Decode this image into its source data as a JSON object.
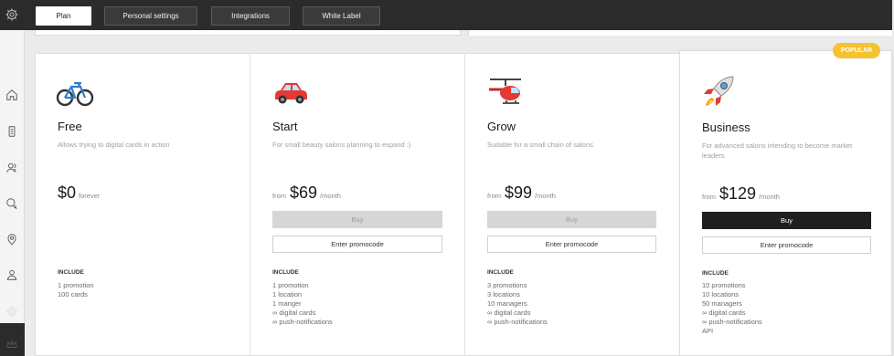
{
  "tabs": [
    "Plan",
    "Personal settings",
    "Integrations",
    "White Label"
  ],
  "badge": "POPULAR",
  "plans": [
    {
      "name": "Free",
      "desc": "Allows trying to digital cards in action",
      "from": "",
      "price": "$0",
      "per": "forever",
      "include": "INCLUDE",
      "features": [
        "1 promotion",
        "100 cards"
      ]
    },
    {
      "name": "Start",
      "desc": "For small beauty salons planning to expand :)",
      "from": "from",
      "price": "$69",
      "per": "/month",
      "buy": "Buy",
      "promo": "Enter promocode",
      "include": "INCLUDE",
      "features": [
        "1 promotion",
        "1 location",
        "1 manger",
        "∞ digital cards",
        "∞ push-notifications"
      ]
    },
    {
      "name": "Grow",
      "desc": "Suitable for a small chain of salons",
      "from": "from",
      "price": "$99",
      "per": "/month",
      "buy": "Buy",
      "promo": "Enter promocode",
      "include": "INCLUDE",
      "features": [
        "3 promotions",
        "3 locations",
        "10 managers",
        "∞ digital cards",
        "∞ push-notifications"
      ]
    },
    {
      "name": "Business",
      "desc": "For advanced salons intending to become market leaders",
      "from": "from",
      "price": "$129",
      "per": "/month",
      "buy": "Buy",
      "promo": "Enter promocode",
      "include": "INCLUDE",
      "features": [
        "10 promotions",
        "10 locations",
        "50 managers",
        "∞ digital cards",
        "∞ push-notifications",
        "API"
      ]
    }
  ],
  "icons": {
    "free": "bicycle-icon",
    "start": "car-icon",
    "grow": "helicopter-icon",
    "business": "rocket-icon"
  },
  "sidebar_icons": [
    "home-icon",
    "clipboard-icon",
    "users-icon",
    "chat-icon",
    "location-icon",
    "user-icon",
    "settings-icon",
    "crown-icon"
  ],
  "colors": {
    "topbar": "#2b2b2b",
    "popular": "#f5c332",
    "buy_enabled": "#1f1f1f",
    "buy_disabled": "#d6d6d6"
  }
}
